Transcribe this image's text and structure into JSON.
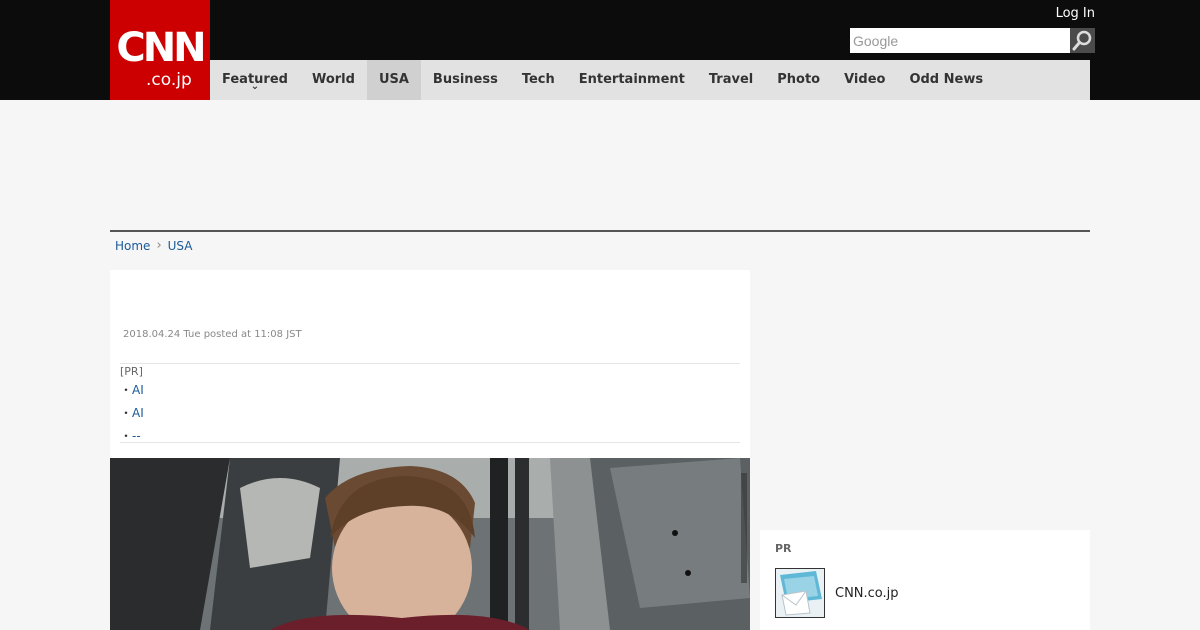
{
  "header": {
    "logo_main": "CNN",
    "logo_sub": ".co.jp",
    "login_label": "Log In",
    "search_placeholder": "Google"
  },
  "nav": {
    "items": [
      {
        "label": "Featured",
        "has_dropdown": true
      },
      {
        "label": "World"
      },
      {
        "label": "USA",
        "active": true
      },
      {
        "label": "Business"
      },
      {
        "label": "Tech"
      },
      {
        "label": "Entertainment"
      },
      {
        "label": "Travel"
      },
      {
        "label": "Photo"
      },
      {
        "label": "Video"
      },
      {
        "label": "Odd News"
      }
    ]
  },
  "breadcrumb": {
    "home": "Home",
    "current": "USA"
  },
  "article": {
    "date": "2018.04.24 Tue posted at 11:08 JST",
    "pr_label": "[PR]",
    "pr_links": [
      "AI",
      "AI",
      "--"
    ]
  },
  "sidebar": {
    "pr_label": "PR",
    "item_text": "CNN.co.jp"
  },
  "colors": {
    "brand_red": "#cc0000",
    "topbar": "#0c0c0c",
    "nav_bg": "#e2e2e2",
    "link": "#1a5a9a"
  }
}
